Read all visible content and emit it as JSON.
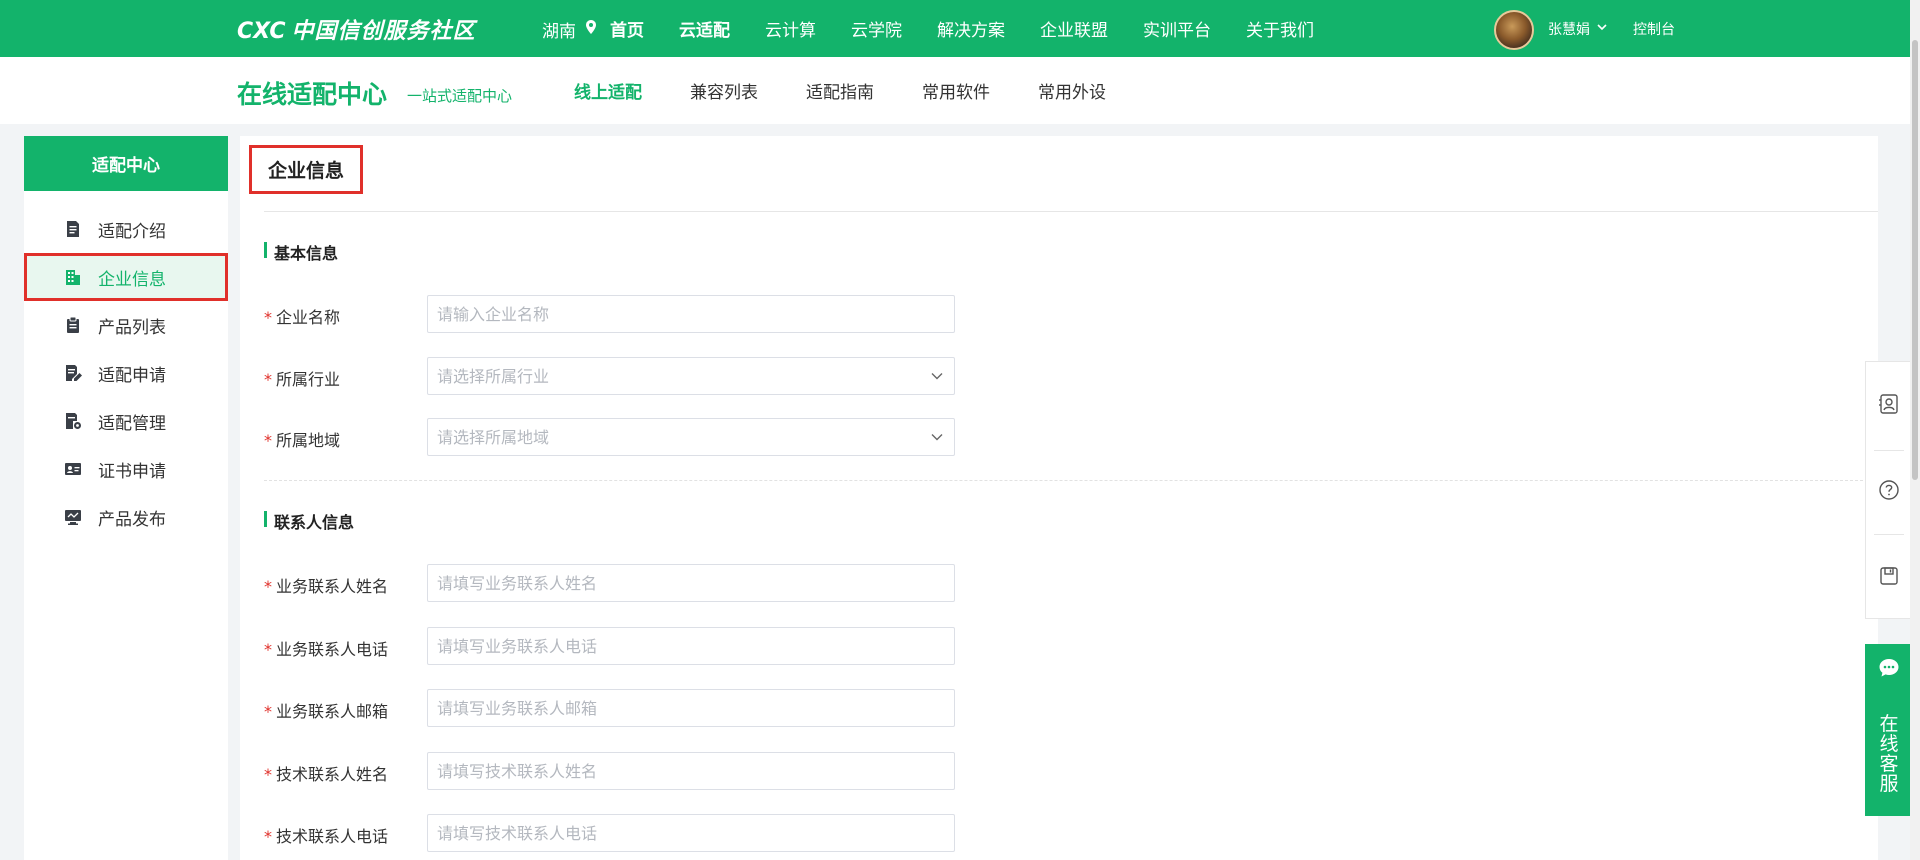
{
  "topnav": {
    "logo_prefix": "CXC",
    "logo_text": "中国信创服务社区",
    "city": "湖南",
    "items": [
      {
        "label": "首页",
        "bold": true
      },
      {
        "label": "云适配",
        "bold": true
      },
      {
        "label": "云计算",
        "bold": false
      },
      {
        "label": "云学院",
        "bold": false
      },
      {
        "label": "解决方案",
        "bold": false
      },
      {
        "label": "企业联盟",
        "bold": false
      },
      {
        "label": "实训平台",
        "bold": false
      },
      {
        "label": "关于我们",
        "bold": false
      }
    ],
    "username": "张慧娟",
    "console_label": "控制台"
  },
  "subhead": {
    "title": "在线适配中心",
    "slogan": "一站式适配中心",
    "tabs": [
      {
        "label": "线上适配",
        "active": true
      },
      {
        "label": "兼容列表",
        "active": false
      },
      {
        "label": "适配指南",
        "active": false
      },
      {
        "label": "常用软件",
        "active": false
      },
      {
        "label": "常用外设",
        "active": false
      }
    ]
  },
  "sidebar": {
    "header": "适配中心",
    "items": [
      {
        "label": "适配介绍",
        "icon": "document-icon",
        "active": false
      },
      {
        "label": "企业信息",
        "icon": "building-icon",
        "active": true
      },
      {
        "label": "产品列表",
        "icon": "clipboard-icon",
        "active": false
      },
      {
        "label": "适配申请",
        "icon": "edit-document-icon",
        "active": false
      },
      {
        "label": "适配管理",
        "icon": "document-settings-icon",
        "active": false
      },
      {
        "label": "证书申请",
        "icon": "id-card-icon",
        "active": false
      },
      {
        "label": "产品发布",
        "icon": "monitor-icon",
        "active": false
      }
    ]
  },
  "main": {
    "page_title": "企业信息",
    "basic_section": "基本信息",
    "contact_section": "联系人信息",
    "required_mark": "*",
    "fields": {
      "company_name": {
        "label": "企业名称",
        "placeholder": "请输入企业名称",
        "value": ""
      },
      "industry": {
        "label": "所属行业",
        "placeholder": "请选择所属行业",
        "value": ""
      },
      "region": {
        "label": "所属地域",
        "placeholder": "请选择所属地域",
        "value": ""
      },
      "biz_contact_name": {
        "label": "业务联系人姓名",
        "placeholder": "请填写业务联系人姓名",
        "value": ""
      },
      "biz_contact_phone": {
        "label": "业务联系人电话",
        "placeholder": "请填写业务联系人电话",
        "value": ""
      },
      "biz_contact_email": {
        "label": "业务联系人邮箱",
        "placeholder": "请填写业务联系人邮箱",
        "value": ""
      },
      "tech_contact_name": {
        "label": "技术联系人姓名",
        "placeholder": "请填写技术联系人姓名",
        "value": ""
      },
      "tech_contact_phone": {
        "label": "技术联系人电话",
        "placeholder": "请填写技术联系人电话",
        "value": ""
      }
    }
  },
  "floatbar": {
    "icons": [
      "contact-card-icon",
      "help-icon",
      "save-icon"
    ],
    "customer_service_label": "在线客服",
    "customer_service_icon": "chat-bubble-icon"
  },
  "colors": {
    "brand_green": "#13b36b",
    "highlight_red": "#e0302a"
  }
}
